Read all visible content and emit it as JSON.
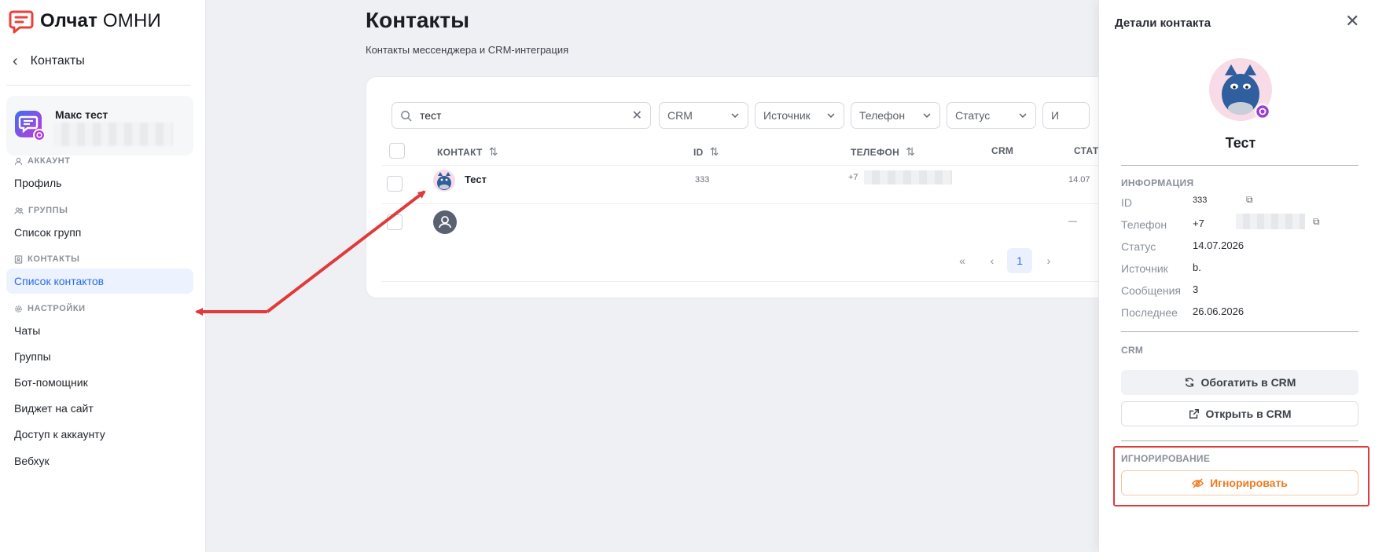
{
  "app": {
    "brand_bold": "Олчат",
    "brand_rest": " ОМНИ"
  },
  "sidebar": {
    "back_label": "Контакты",
    "account": {
      "name": "Макс тест"
    },
    "sections": {
      "account": "АККАУНТ",
      "groups": "ГРУППЫ",
      "contacts": "КОНТАКТЫ",
      "settings": "НАСТРОЙКИ"
    },
    "items": {
      "profile": "Профиль",
      "groups_list": "Список групп",
      "contacts_list": "Список контактов",
      "chats": "Чаты",
      "groups": "Группы",
      "bot": "Бот-помощник",
      "widget": "Виджет на сайт",
      "access": "Доступ к аккаунту",
      "webhook": "Вебхук"
    }
  },
  "main": {
    "title": "Контакты",
    "subtitle": "Контакты мессенджера и CRM-интеграция",
    "search": {
      "value": "тест"
    },
    "filters": [
      "CRM",
      "Источник",
      "Телефон",
      "Статус",
      "И"
    ],
    "columns": {
      "contact": "КОНТАКТ",
      "id": "ID",
      "phone": "ТЕЛЕФОН",
      "crm": "CRM",
      "status": "СТАТУ"
    },
    "rows": [
      {
        "name": "Тест",
        "id": "333",
        "phone": "+7",
        "status": "14.07"
      },
      {
        "name": "",
        "id": "",
        "phone": "",
        "status": "—"
      }
    ],
    "pagination": {
      "first": "«",
      "prev": "‹",
      "current": "1",
      "next": "›"
    }
  },
  "panel": {
    "title": "Детали контакта",
    "contact_name": "Тест",
    "info_label": "ИНФОРМАЦИЯ",
    "fields": {
      "id": {
        "key": "ID",
        "value": "333"
      },
      "phone": {
        "key": "Телефон",
        "value": "+7"
      },
      "status": {
        "key": "Статус",
        "value": "14.07.2026"
      },
      "source": {
        "key": "Источник",
        "value": "b."
      },
      "messages": {
        "key": "Сообщения",
        "value": "3"
      },
      "last": {
        "key": "Последнее",
        "value": "26.06.2026"
      }
    },
    "crm_label": "CRM",
    "enrich_button": "Обогатить в CRM",
    "open_button": "Открыть в CRM",
    "ignore_label": "ИГНОРИРОВАНИЕ",
    "ignore_button": "Игнорировать"
  },
  "colors": {
    "accent": "#2b6be8",
    "ignore": "#f07a1e",
    "annotation": "#e03a3a",
    "logo": "#e8413b"
  }
}
